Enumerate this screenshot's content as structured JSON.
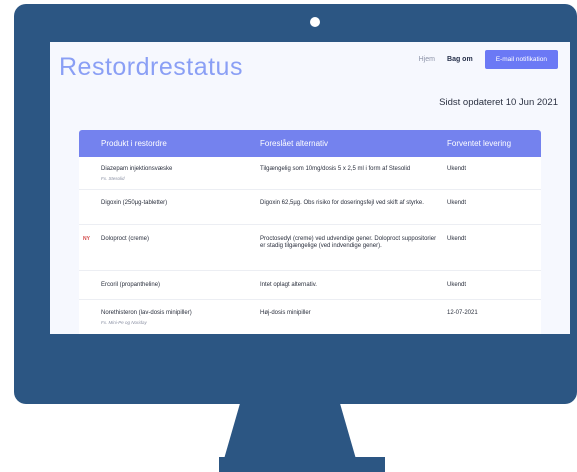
{
  "site": {
    "title": "Restordrestatus"
  },
  "nav": {
    "home": "Hjem",
    "about": "Bag om",
    "notify_button": "E-mail notifikation"
  },
  "updated": "Sidst opdateret 10 Jun 2021",
  "table": {
    "headers": [
      "Produkt i restordre",
      "Foreslået alternativ",
      "Forventet levering"
    ],
    "rows": [
      {
        "tag": "",
        "product": "Diazepam injektionsvæske",
        "example": "Fx. Stesolid",
        "alternative": "Tilgængelig som 10mg/dosis 5 x 2,5 ml i form af Stesolid",
        "delivery": "Ukendt"
      },
      {
        "tag": "",
        "product": "Digoxin (250µg-tabletter)",
        "example": "",
        "alternative": "Digoxin 62,5µg. Obs risiko for doseringsfejl ved skift af styrke.",
        "delivery": "Ukendt"
      },
      {
        "tag": "NY",
        "product": "Doloproct (creme)",
        "example": "",
        "alternative": "Proctosedyl (creme) ved udvendige gener. Doloproct suppositorier er stadig tilgængelige (ved indvendige gener).",
        "delivery": "Ukendt"
      },
      {
        "tag": "",
        "product": "Ercoril (propantheline)",
        "example": "",
        "alternative": "Intet oplagt alternativ.",
        "delivery": "Ukendt"
      },
      {
        "tag": "",
        "product": "Norethisteron (lav-dosis minipiller)",
        "example": "Fx. Mini-Pe og Noriday",
        "alternative": "Høj-dosis minipiller",
        "delivery": "12-07-2021"
      }
    ]
  },
  "colors": {
    "monitor": "#2c5683",
    "accent": "#6b79f5",
    "header_bg": "#7482ee",
    "title": "#8a9ff5",
    "new_tag": "#d24646"
  }
}
